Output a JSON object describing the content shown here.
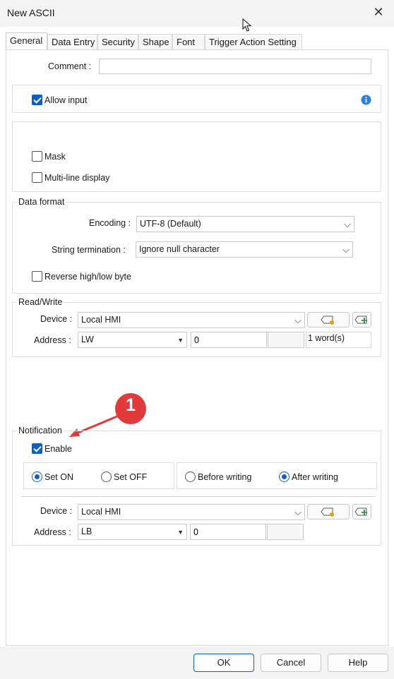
{
  "window": {
    "title": "New ASCII"
  },
  "tabs": [
    {
      "label": "General",
      "active": true
    },
    {
      "label": "Data Entry"
    },
    {
      "label": "Security"
    },
    {
      "label": "Shape"
    },
    {
      "label": "Font"
    },
    {
      "label": "Trigger Action Setting"
    }
  ],
  "comment": {
    "label": "Comment :",
    "value": ""
  },
  "allow_input": {
    "label": "Allow input",
    "checked": true,
    "info_icon": "info-icon"
  },
  "options": {
    "mask": {
      "label": "Mask",
      "checked": false
    },
    "multiline": {
      "label": "Multi-line display",
      "checked": false
    }
  },
  "data_format": {
    "title": "Data format",
    "encoding_label": "Encoding :",
    "encoding_value": "UTF-8 (Default)",
    "termination_label": "String termination :",
    "termination_value": "Ignore null character",
    "reverse_label": "Reverse high/low byte",
    "reverse_checked": false
  },
  "read_write": {
    "title": "Read/Write",
    "device_label": "Device :",
    "device_value": "Local HMI",
    "address_label": "Address :",
    "address_type": "LW",
    "address_value": "0",
    "word_count": "1 word(s)"
  },
  "annotation": {
    "number": "1",
    "color": "#e03a3a"
  },
  "notification": {
    "title": "Notification",
    "enable_label": "Enable",
    "enable_checked": true,
    "set_on_label": "Set ON",
    "set_off_label": "Set OFF",
    "set_selected": "Set ON",
    "before_label": "Before writing",
    "after_label": "After writing",
    "timing_selected": "After writing",
    "device_label": "Device :",
    "device_value": "Local HMI",
    "address_label": "Address :",
    "address_type": "LB",
    "address_value": "0"
  },
  "footer": {
    "ok_label": "OK",
    "cancel_label": "Cancel",
    "help_label": "Help"
  },
  "colors": {
    "accent": "#0f5fbf",
    "annotation": "#e03a3a",
    "tag_icon": "#e8962a",
    "add_icon": "#3a9a4a"
  }
}
